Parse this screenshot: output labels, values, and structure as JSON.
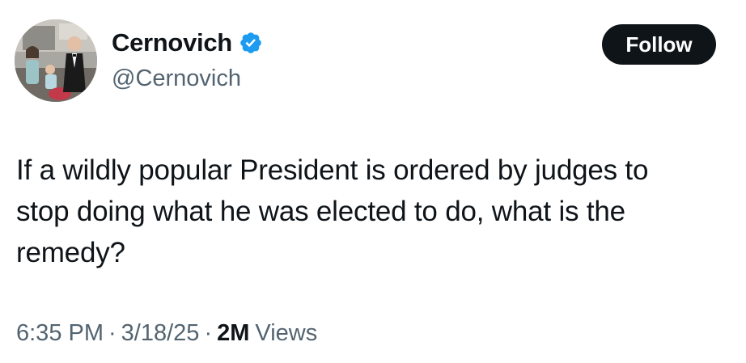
{
  "author": {
    "display_name": "Cernovich",
    "handle": "@Cernovich",
    "verified_badge_icon": "verified-badge-icon",
    "verified_color": "#1d9bf0"
  },
  "follow_button": {
    "label": "Follow"
  },
  "tweet": {
    "line1": "If a wildly popular President is ordered by judges to",
    "line2": "stop doing what he was elected to do, what is the",
    "line3": "remedy?"
  },
  "meta": {
    "time": "6:35 PM",
    "separator": "·",
    "date": "3/18/25",
    "view_count": "2M",
    "views_label": "Views"
  },
  "colors": {
    "text_primary": "#0f1419",
    "text_secondary": "#536471",
    "button_bg": "#0f1419",
    "button_text": "#ffffff"
  }
}
